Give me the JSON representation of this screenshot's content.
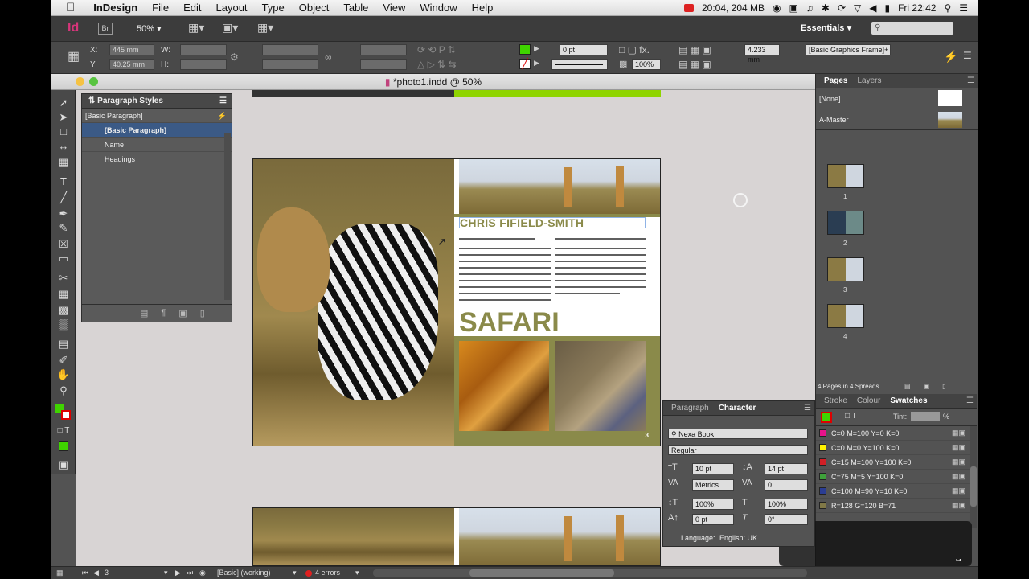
{
  "menubar": {
    "app_name": "InDesign",
    "items": [
      "File",
      "Edit",
      "Layout",
      "Type",
      "Object",
      "Table",
      "View",
      "Window",
      "Help"
    ],
    "status": "20:04, 204 MB",
    "clock": "Fri 22:42"
  },
  "appbar": {
    "logo": "Id",
    "bridge": "Br",
    "zoom": "50%",
    "workspace": "Essentials"
  },
  "control": {
    "x_label": "X:",
    "y_label": "Y:",
    "w_label": "W:",
    "h_label": "H:",
    "x_value": "445 mm",
    "y_value": "40.25 mm",
    "stroke_weight": "0 pt",
    "opacity": "100%",
    "size_value": "4.233 mm",
    "object_style": "[Basic Graphics Frame]+"
  },
  "document": {
    "tab_title": "*photo1.indd @ 50%",
    "headline_name": "CHRIS FIFIELD-SMITH",
    "headline_title": "SAFARI",
    "page_number": "3"
  },
  "paragraph_styles": {
    "title": "Paragraph Styles",
    "current": "[Basic Paragraph]",
    "items": [
      "[Basic Paragraph]",
      "Name",
      "Headings"
    ]
  },
  "pages_panel": {
    "tabs": [
      "Pages",
      "Layers"
    ],
    "masters": [
      "[None]",
      "A-Master"
    ],
    "page_labels": [
      "1",
      "2",
      "3",
      "4"
    ],
    "footer": "4 Pages in 4 Spreads"
  },
  "swatches_panel": {
    "tabs": [
      "Stroke",
      "Colour",
      "Swatches"
    ],
    "tint_label": "Tint:",
    "tint_unit": "%",
    "swatches": [
      {
        "name": "C=0 M=100 Y=0 K=0",
        "color": "#e8138b"
      },
      {
        "name": "C=0 M=0 Y=100 K=0",
        "color": "#fff200"
      },
      {
        "name": "C=15 M=100 Y=100 K=0",
        "color": "#d11f26"
      },
      {
        "name": "C=75 M=5 Y=100 K=0",
        "color": "#3ea13a"
      },
      {
        "name": "C=100 M=90 Y=10 K=0",
        "color": "#2b3d93"
      },
      {
        "name": "R=128 G=120 B=71",
        "color": "#807847"
      }
    ]
  },
  "character_panel": {
    "tabs": [
      "Paragraph",
      "Character"
    ],
    "font": "Nexa Book",
    "style": "Regular",
    "size": "10 pt",
    "leading": "14 pt",
    "kerning": "Metrics",
    "tracking": "0",
    "vscale": "100%",
    "hscale": "100%",
    "baseline": "0 pt",
    "skew": "0°",
    "language_label": "Language:",
    "language": "English: UK"
  },
  "statusbar": {
    "page": "3",
    "style": "[Basic] (working)",
    "errors": "4 errors"
  },
  "colors": {
    "accent_green": "#8fd400",
    "olive": "#8a8a4a",
    "selection_blue": "#3b5a86"
  }
}
